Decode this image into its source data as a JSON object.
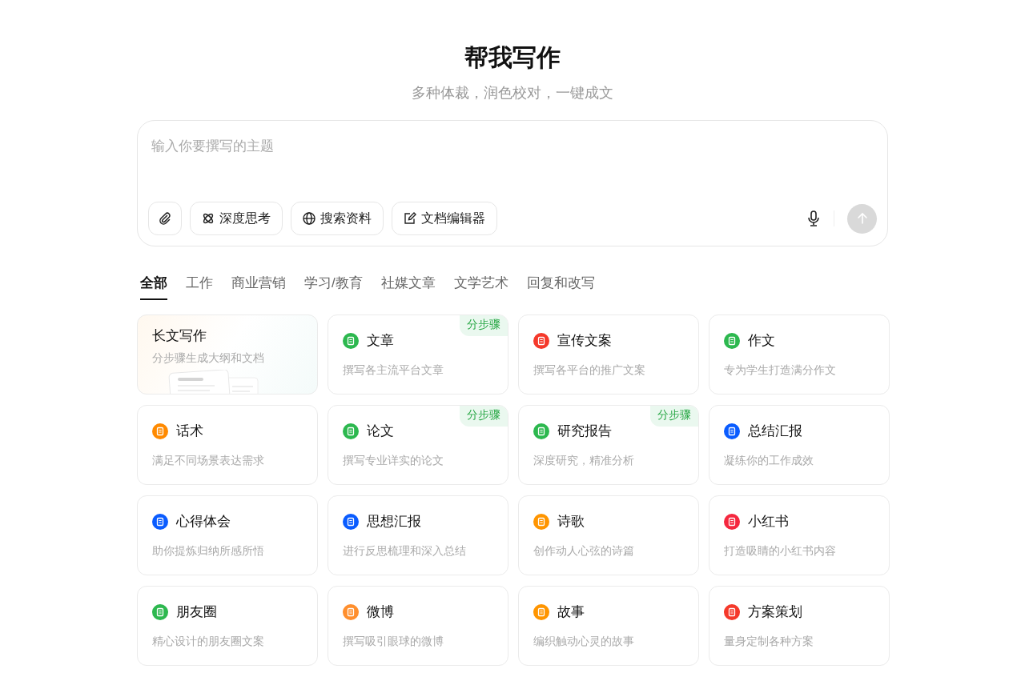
{
  "header": {
    "title": "帮我写作",
    "subtitle": "多种体裁，润色校对，一键成文"
  },
  "composer": {
    "placeholder": "输入你要撰写的主题",
    "tools": [
      {
        "kind": "attach"
      },
      {
        "kind": "think",
        "label": "深度思考"
      },
      {
        "kind": "search",
        "label": "搜索资料"
      },
      {
        "kind": "editor",
        "label": "文档编辑器"
      }
    ],
    "send_disabled": true
  },
  "tabs": [
    {
      "label": "全部",
      "selected": true
    },
    {
      "label": "工作",
      "selected": false
    },
    {
      "label": "商业营销",
      "selected": false
    },
    {
      "label": "学习/教育",
      "selected": false
    },
    {
      "label": "社媒文章",
      "selected": false
    },
    {
      "label": "文学艺术",
      "selected": false
    },
    {
      "label": "回复和改写",
      "selected": false
    }
  ],
  "cards": [
    {
      "kind": "feature",
      "title": "长文写作",
      "description": "分步骤生成大纲和文档"
    },
    {
      "kind": "template",
      "title": "文章",
      "description": "撰写各主流平台文章",
      "color": "#2db84f",
      "badge": "分步骤"
    },
    {
      "kind": "template",
      "title": "宣传文案",
      "description": "撰写各平台的推广文案",
      "color": "#f5392b"
    },
    {
      "kind": "template",
      "title": "作文",
      "description": "专为学生打造满分作文",
      "color": "#2db84f"
    },
    {
      "kind": "template",
      "title": "话术",
      "description": "满足不同场景表达需求",
      "color": "#ff8a00"
    },
    {
      "kind": "template",
      "title": "论文",
      "description": "撰写专业详实的论文",
      "color": "#2db84f",
      "badge": "分步骤"
    },
    {
      "kind": "template",
      "title": "研究报告",
      "description": "深度研究，精准分析",
      "color": "#2db84f",
      "badge": "分步骤"
    },
    {
      "kind": "template",
      "title": "总结汇报",
      "description": "凝练你的工作成效",
      "color": "#0a5cff"
    },
    {
      "kind": "template",
      "title": "心得体会",
      "description": "助你提炼归纳所感所悟",
      "color": "#0a5cff"
    },
    {
      "kind": "template",
      "title": "思想汇报",
      "description": "进行反思梳理和深入总结",
      "color": "#0a5cff"
    },
    {
      "kind": "template",
      "title": "诗歌",
      "description": "创作动人心弦的诗篇",
      "color": "#ff9500"
    },
    {
      "kind": "template",
      "title": "小红书",
      "description": "打造吸睛的小红书内容",
      "color": "#f5283f"
    },
    {
      "kind": "template",
      "title": "朋友圈",
      "description": "精心设计的朋友圈文案",
      "color": "#2db84f"
    },
    {
      "kind": "template",
      "title": "微博",
      "description": "撰写吸引眼球的微博",
      "color": "#ff8f2e"
    },
    {
      "kind": "template",
      "title": "故事",
      "description": "编织触动心灵的故事",
      "color": "#ff9500"
    },
    {
      "kind": "template",
      "title": "方案策划",
      "description": "量身定制各种方案",
      "color": "#f5392b"
    }
  ]
}
